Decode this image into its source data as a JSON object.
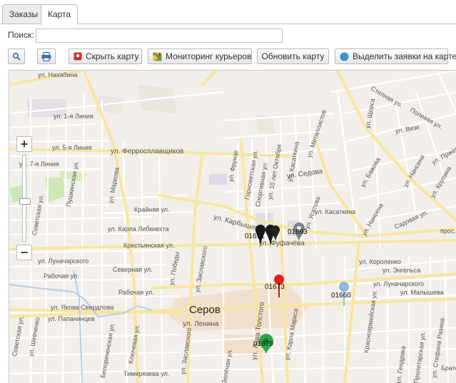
{
  "tabs": [
    {
      "label": "Заказы",
      "active": false
    },
    {
      "label": "Карта",
      "active": true
    }
  ],
  "search": {
    "label": "Поиск:",
    "value": "",
    "placeholder": ""
  },
  "toolbar": {
    "search_icon": "magnifier-icon",
    "print_icon": "printer-icon",
    "hide_map": "Скрыть карту",
    "monitoring": "Мониторинг курьеров",
    "refresh_map": "Обновить карту",
    "highlight_orders": "Выделить заявки на карте"
  },
  "map": {
    "city": "Серов",
    "streets": [
      "ул. Нахабина",
      "ул. 1-я Линия",
      "ул. 5-я Линия",
      "ул. 7-я Линия",
      "ул. Ферросплавщиков",
      "Пушкинская ул.",
      "ул. Маркова",
      "Советская ул.",
      "ул. Луначарского",
      "Рабочая ул.",
      "ул. Якова Свердлова",
      "ул. Папанинцев",
      "ул. Шевченко",
      "Белореченская ул.",
      "Ключевая ул.",
      "Крайняя ул.",
      "ул. Карла Либкнехта",
      "Крестьянская ул.",
      "Северная ул.",
      "Рабочая ул.",
      "ул. Победы",
      "ул. Заславского",
      "ул. Ленина",
      "Тимирязева ул.",
      "ул. Карбышева",
      "ул. Фрунзе",
      "Горноветская ул.",
      "Спортивная ул.",
      "ул. 10 лет Октября",
      "ул. Касаткина",
      "ул. Металлистов",
      "ул. Седова",
      "ул. Фуфачёва",
      "ул. Усатова",
      "ул. Касаткина",
      "ул. Щорса",
      "Степная ул.",
      "Полевая ул.",
      "ул. Визе",
      "ул. Пржевальского",
      "ул. Бажова",
      "ул. Нансена",
      "ул. Крупина",
      "Садовая ул.",
      "ул. Нансена",
      "ул. Короленко",
      "ул. Энгельса",
      "ул. Луначарского",
      "ул. Малышева",
      "Красноармейская ул.",
      "ул. Льва Толстого",
      "ул. Карла Маркса",
      "Зелёная ул.",
      "Пролетарская ул.",
      "ул. Гендрика",
      "ул. Стефана Разина",
      "Братс...",
      "прос...",
      "Советская ул.",
      "ул. Заславского"
    ],
    "markers": [
      {
        "id": "01691",
        "color": "#1a1a1a"
      },
      {
        "id": "01693",
        "color": "#7a8582"
      },
      {
        "id": "01673",
        "color": "#e02020"
      },
      {
        "id": "01660",
        "color": "#8fb8e8"
      },
      {
        "id": "01679",
        "color": "#2aa84a"
      }
    ]
  },
  "zoom": {
    "plus": "+",
    "minus": "−"
  }
}
